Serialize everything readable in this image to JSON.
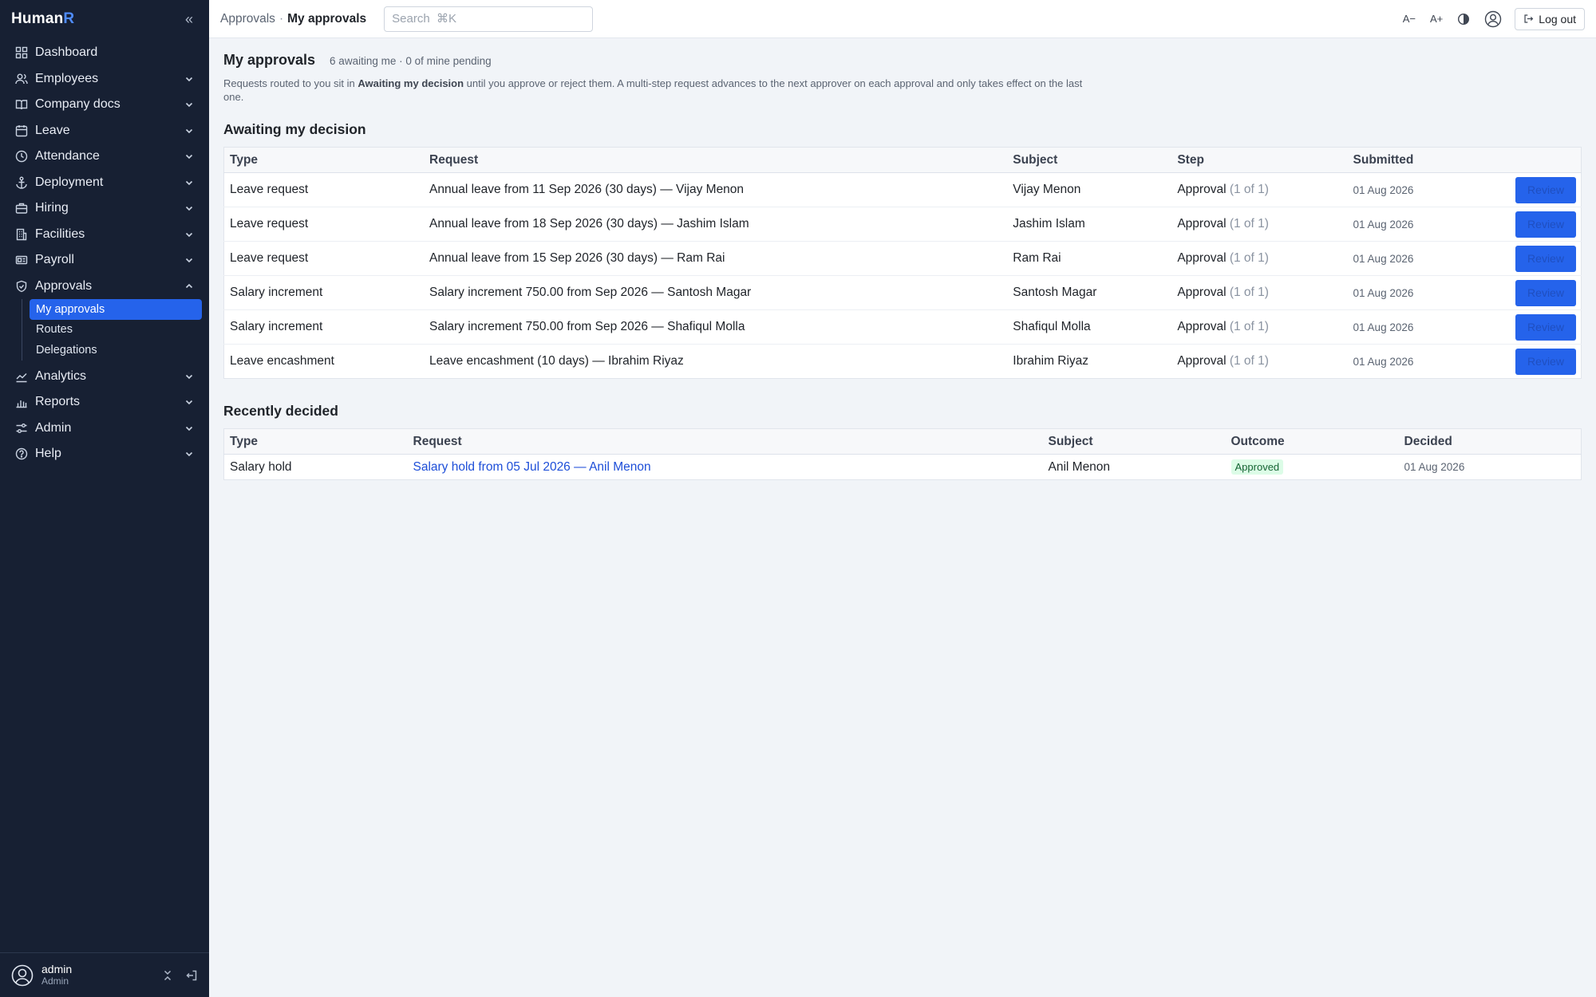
{
  "brand": {
    "name": "Human",
    "accent": "R"
  },
  "sidebar": {
    "items": [
      {
        "label": "Dashboard",
        "icon": "grid-icon"
      },
      {
        "label": "Employees",
        "icon": "users-icon"
      },
      {
        "label": "Company docs",
        "icon": "book-icon"
      },
      {
        "label": "Leave",
        "icon": "calendar-icon"
      },
      {
        "label": "Attendance",
        "icon": "clock-icon"
      },
      {
        "label": "Deployment",
        "icon": "anchor-icon"
      },
      {
        "label": "Hiring",
        "icon": "briefcase-icon"
      },
      {
        "label": "Facilities",
        "icon": "building-icon"
      },
      {
        "label": "Payroll",
        "icon": "payroll-icon"
      },
      {
        "label": "Approvals",
        "icon": "shield-check-icon"
      },
      {
        "label": "Analytics",
        "icon": "chart-line-icon"
      },
      {
        "label": "Reports",
        "icon": "bar-chart-icon"
      },
      {
        "label": "Admin",
        "icon": "sliders-icon"
      },
      {
        "label": "Help",
        "icon": "help-icon"
      }
    ],
    "approvals_sub": [
      {
        "label": "My approvals"
      },
      {
        "label": "Routes"
      },
      {
        "label": "Delegations"
      }
    ],
    "user": {
      "name": "admin",
      "role": "Admin"
    }
  },
  "topbar": {
    "breadcrumb_parent": "Approvals",
    "breadcrumb_sep": "·",
    "breadcrumb_current": "My approvals",
    "search_placeholder": "Search  ⌘K",
    "font_decrease": "A−",
    "font_increase": "A+",
    "logout": "Log out"
  },
  "page": {
    "title": "My approvals",
    "meta": "6 awaiting me · 0 of mine pending",
    "intro_pre": "Requests routed to you sit in ",
    "intro_bold": "Awaiting my decision",
    "intro_post": " until you approve or reject them. A multi-step request advances to the next approver on each approval and only takes effect on the last one."
  },
  "awaiting": {
    "title": "Awaiting my decision",
    "columns": [
      "Type",
      "Request",
      "Subject",
      "Step",
      "Submitted",
      ""
    ],
    "rows": [
      {
        "type": "Leave request",
        "request": "Annual leave from 11 Sep 2026 (30 days) — Vijay Menon",
        "subject": "Vijay Menon",
        "step": "Approval",
        "step_of": "(1 of 1)",
        "submitted": "01 Aug 2026",
        "action": "Review"
      },
      {
        "type": "Leave request",
        "request": "Annual leave from 18 Sep 2026 (30 days) — Jashim Islam",
        "subject": "Jashim Islam",
        "step": "Approval",
        "step_of": "(1 of 1)",
        "submitted": "01 Aug 2026",
        "action": "Review"
      },
      {
        "type": "Leave request",
        "request": "Annual leave from 15 Sep 2026 (30 days) — Ram Rai",
        "subject": "Ram Rai",
        "step": "Approval",
        "step_of": "(1 of 1)",
        "submitted": "01 Aug 2026",
        "action": "Review"
      },
      {
        "type": "Salary increment",
        "request": "Salary increment 750.00 from Sep 2026 — Santosh Magar",
        "subject": "Santosh Magar",
        "step": "Approval",
        "step_of": "(1 of 1)",
        "submitted": "01 Aug 2026",
        "action": "Review"
      },
      {
        "type": "Salary increment",
        "request": "Salary increment 750.00 from Sep 2026 — Shafiqul Molla",
        "subject": "Shafiqul Molla",
        "step": "Approval",
        "step_of": "(1 of 1)",
        "submitted": "01 Aug 2026",
        "action": "Review"
      },
      {
        "type": "Leave encashment",
        "request": "Leave encashment (10 days) — Ibrahim Riyaz",
        "subject": "Ibrahim Riyaz",
        "step": "Approval",
        "step_of": "(1 of 1)",
        "submitted": "01 Aug 2026",
        "action": "Review"
      }
    ]
  },
  "recent": {
    "title": "Recently decided",
    "columns": [
      "Type",
      "Request",
      "Subject",
      "Outcome",
      "Decided"
    ],
    "rows": [
      {
        "type": "Salary hold",
        "request": "Salary hold from 05 Jul 2026 — Anil Menon",
        "subject": "Anil Menon",
        "outcome": "Approved",
        "decided": "01 Aug 2026"
      }
    ]
  },
  "colors": {
    "sidebar_bg": "#172033",
    "accent": "#2563eb",
    "page_bg": "#f1f4f8",
    "approved_bg": "#dcfce7",
    "approved_text": "#166534"
  }
}
